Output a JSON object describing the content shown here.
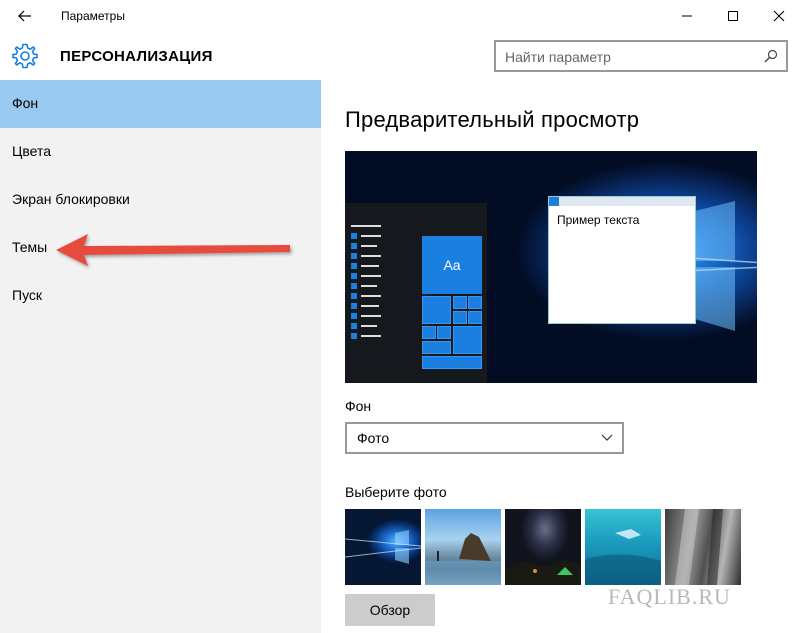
{
  "window": {
    "title": "Параметры",
    "back_icon": "arrow-left-icon",
    "controls": [
      "minimize-icon",
      "maximize-icon",
      "close-icon"
    ]
  },
  "header": {
    "icon": "gear-icon",
    "title": "ПЕРСОНАЛИЗАЦИЯ",
    "search_placeholder": "Найти параметр",
    "search_icon": "search-icon"
  },
  "sidebar": {
    "items": [
      {
        "label": "Фон",
        "active": true
      },
      {
        "label": "Цвета",
        "active": false
      },
      {
        "label": "Экран блокировки",
        "active": false
      },
      {
        "label": "Темы",
        "active": false
      },
      {
        "label": "Пуск",
        "active": false
      }
    ]
  },
  "annotation": {
    "icon": "red-arrow-icon",
    "color": "#e64b3c"
  },
  "main": {
    "preview_title": "Предварительный просмотр",
    "preview": {
      "tile_text": "Aa",
      "window_text": "Пример текста"
    },
    "background_label": "Фон",
    "background_value": "Фото",
    "choose_label": "Выберите фото",
    "browse_label": "Обзор"
  },
  "colors": {
    "accent": "#1a7fe0",
    "active_item": "#99c9ef",
    "sidebar_bg": "#f2f2f2"
  },
  "watermark": "FAQLIB.RU"
}
